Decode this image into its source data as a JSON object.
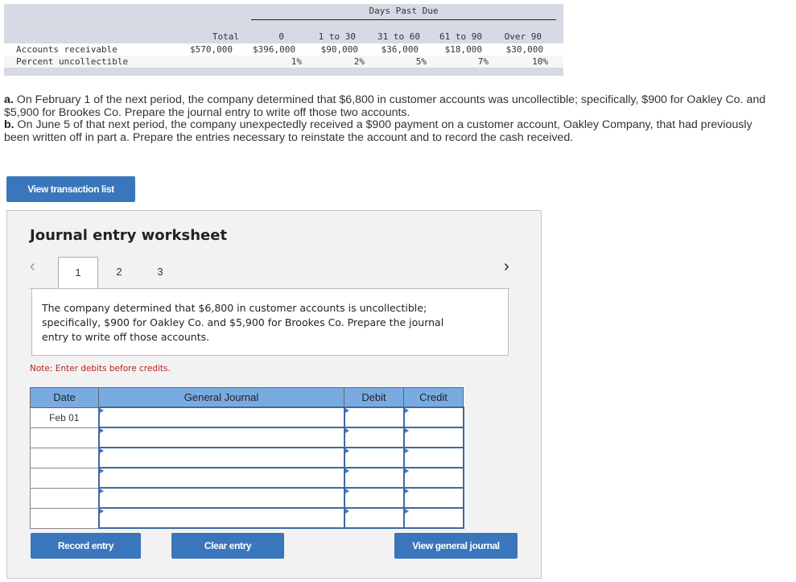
{
  "aging_table": {
    "group_header": "Days Past Due",
    "columns": [
      "Total",
      "0",
      "1 to 30",
      "31 to 60",
      "61 to 90",
      "Over 90"
    ],
    "rows": [
      {
        "label": "Accounts receivable",
        "values": [
          "$570,000",
          "$396,000",
          "$90,000",
          "$36,000",
          "$18,000",
          "$30,000"
        ]
      },
      {
        "label": "Percent uncollectible",
        "values": [
          "",
          "1%",
          "2%",
          "5%",
          "7%",
          "10%"
        ]
      }
    ]
  },
  "problem": {
    "part_a_label": "a.",
    "part_a_text": " On February 1 of the next period, the company determined that $6,800 in customer accounts was uncollectible; specifically, $900 for Oakley Co. and $5,900 for Brookes Co. Prepare the journal entry to write off those two accounts.",
    "part_b_label": "b.",
    "part_b_text": " On June 5 of that next period, the company unexpectedly received a $900 payment on a customer account, Oakley Company, that had previously been written off in part a. Prepare the entries necessary to reinstate the account and to record the cash received."
  },
  "buttons": {
    "view_transaction_list": "View transaction list",
    "record_entry": "Record entry",
    "clear_entry": "Clear entry",
    "view_general_journal": "View general journal"
  },
  "worksheet": {
    "title": "Journal entry worksheet",
    "prev_arrow": "‹",
    "next_arrow": "›",
    "tabs": [
      "1",
      "2",
      "3"
    ],
    "active_tab": "1",
    "description": "The company determined that $6,800 in customer accounts is uncollectible; specifically, $900 for Oakley Co. and $5,900 for Brookes Co. Prepare the journal entry to write off those accounts.",
    "note": "Note: Enter debits before credits.",
    "table": {
      "headers": [
        "Date",
        "General Journal",
        "Debit",
        "Credit"
      ],
      "rows": [
        {
          "date": "Feb 01",
          "account": "",
          "debit": "",
          "credit": ""
        },
        {
          "date": "",
          "account": "",
          "debit": "",
          "credit": ""
        },
        {
          "date": "",
          "account": "",
          "debit": "",
          "credit": ""
        },
        {
          "date": "",
          "account": "",
          "debit": "",
          "credit": ""
        },
        {
          "date": "",
          "account": "",
          "debit": "",
          "credit": ""
        },
        {
          "date": "",
          "account": "",
          "debit": "",
          "credit": ""
        }
      ]
    }
  }
}
